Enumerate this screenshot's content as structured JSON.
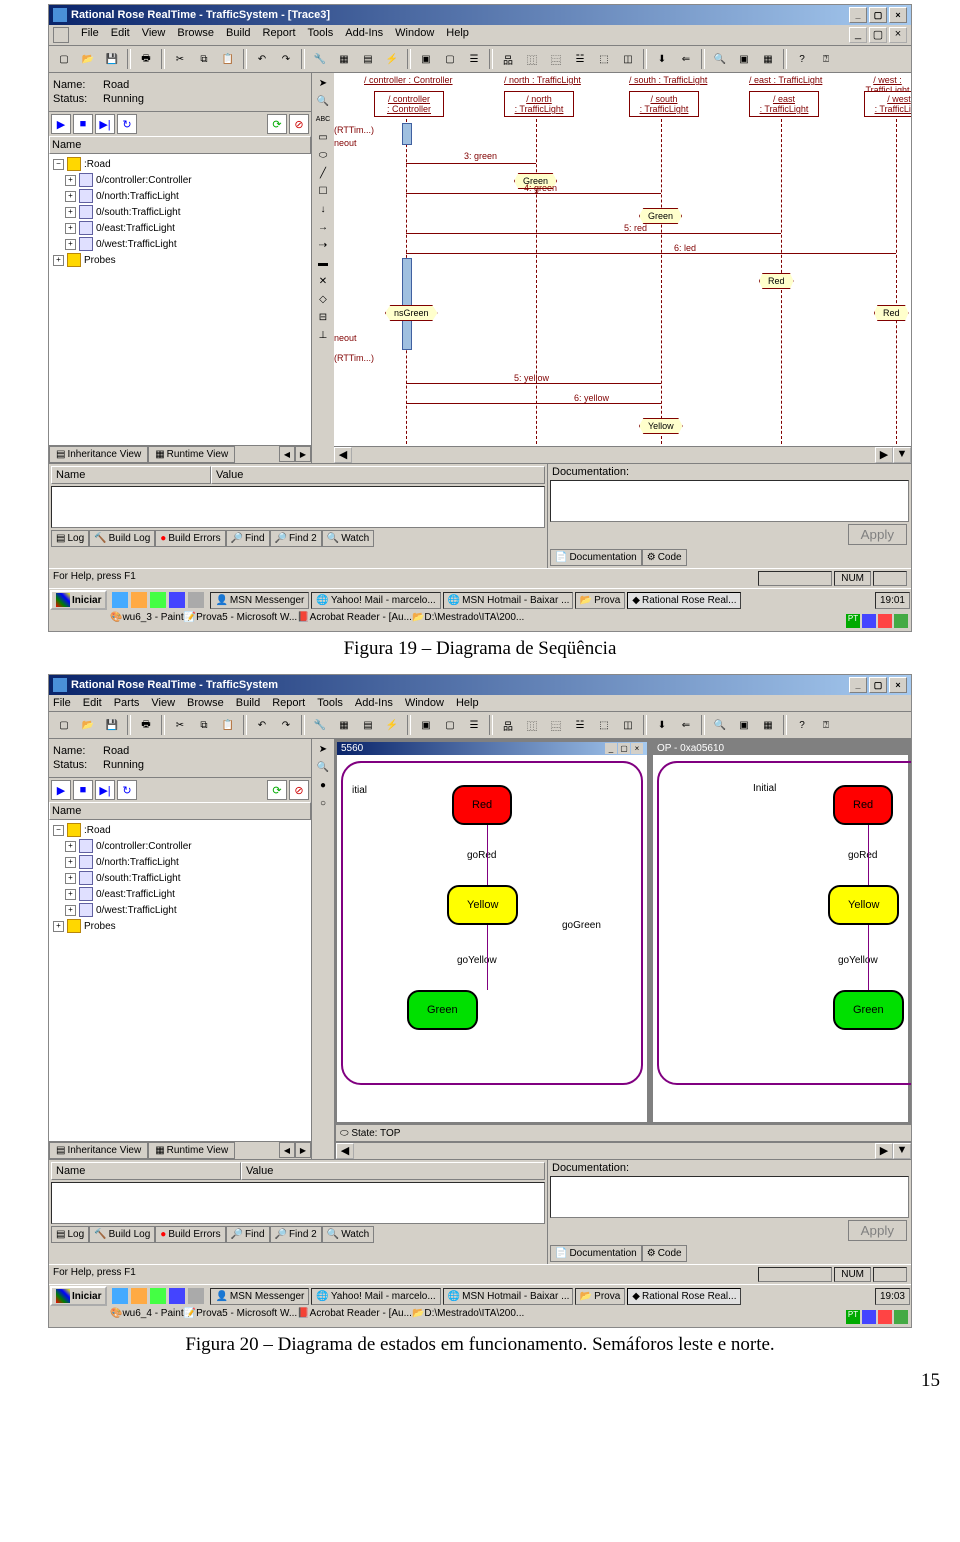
{
  "page_number": "15",
  "caption1": "Figura 19 – Diagrama de Seqüência",
  "caption2": "Figura 20 – Diagrama de estados em funcionamento. Semáforos leste e norte.",
  "shot1": {
    "title": "Rational Rose RealTime - TrafficSystem - [Trace3]",
    "menu": [
      "File",
      "Edit",
      "View",
      "Browse",
      "Build",
      "Report",
      "Tools",
      "Add-Ins",
      "Window",
      "Help"
    ],
    "name_label": "Name:",
    "name_value": "Road",
    "status_label": "Status:",
    "status_value": "Running",
    "tree_hdr": "Name",
    "tree": {
      "root": ":Road",
      "items": [
        "0/controller:Controller",
        "0/north:TrafficLight",
        "0/south:TrafficLight",
        "0/east:TrafficLight",
        "0/west:TrafficLight"
      ],
      "probes": "Probes"
    },
    "tabs": {
      "inh": "Inheritance View",
      "run": "Runtime View"
    },
    "lifelines": [
      {
        "hdr": "/ controller : Controller",
        "box": "/ controller\n: Controller"
      },
      {
        "hdr": "/ north : TrafficLight",
        "box": "/ north\n: TrafficLight"
      },
      {
        "hdr": "/ south : TrafficLight",
        "box": "/ south\n: TrafficLight"
      },
      {
        "hdr": "/ east : TrafficLight",
        "box": "/ east\n: TrafficLight"
      },
      {
        "hdr": "/ west : TrafficLight",
        "box": "/ west\n: TrafficLight"
      }
    ],
    "messages": {
      "m3": "3: green",
      "m4": "4: green",
      "m5": "5: red",
      "m6": "6: led",
      "m5y": "5: yellow",
      "m6y": "6: yellow"
    },
    "states": {
      "green": "Green",
      "red": "Red",
      "yellow": "Yellow",
      "nsGreen": "nsGreen"
    },
    "trunc": {
      "neout": "neout",
      "rttim": "(RTTim...)"
    },
    "bottom": {
      "name": "Name",
      "value": "Value",
      "doc": "Documentation:",
      "apply": "Apply",
      "tabs": [
        "Log",
        "Build Log",
        "Build Errors",
        "Find",
        "Find 2",
        "Watch"
      ],
      "rtabs": [
        "Documentation",
        "Code"
      ]
    },
    "status": {
      "help": "For Help, press F1",
      "num": "NUM"
    },
    "taskbar": {
      "start": "Iniciar",
      "tasks1": [
        "MSN Messenger",
        "Yahoo! Mail - marcelo...",
        "MSN Hotmail - Baixar ...",
        "Prova",
        "Rational Rose Real..."
      ],
      "tasks2": [
        "wu6_3 - Paint",
        "Prova5 - Microsoft W...",
        "Acrobat Reader - [Au...",
        "D:\\Mestrado\\ITA\\200..."
      ],
      "time": "19:01"
    }
  },
  "shot2": {
    "title": "Rational Rose RealTime - TrafficSystem",
    "menu": [
      "File",
      "Edit",
      "Parts",
      "View",
      "Browse",
      "Build",
      "Report",
      "Tools",
      "Add-Ins",
      "Window",
      "Help"
    ],
    "name_label": "Name:",
    "name_value": "Road",
    "status_label": "Status:",
    "status_value": "Running",
    "tree_hdr": "Name",
    "tree": {
      "root": ":Road",
      "items": [
        "0/controller:Controller",
        "0/north:TrafficLight",
        "0/south:TrafficLight",
        "0/east:TrafficLight",
        "0/west:TrafficLight"
      ],
      "probes": "Probes"
    },
    "tabs": {
      "inh": "Inheritance View",
      "run": "Runtime View"
    },
    "win1_title": "5560",
    "win2_title": "OP - 0xa05610",
    "states": {
      "initial": "Initial",
      "red": "Red",
      "yellow": "Yellow",
      "green": "Green"
    },
    "transitions": {
      "goRed": "goRed",
      "goYellow": "goYellow",
      "goGreen": "goGreen"
    },
    "statebar": "State: TOP",
    "bottom": {
      "name": "Name",
      "value": "Value",
      "doc": "Documentation:",
      "apply": "Apply",
      "tabs": [
        "Log",
        "Build Log",
        "Build Errors",
        "Find",
        "Find 2",
        "Watch"
      ],
      "rtabs": [
        "Documentation",
        "Code"
      ]
    },
    "status": {
      "help": "For Help, press F1",
      "num": "NUM"
    },
    "taskbar": {
      "start": "Iniciar",
      "tasks1": [
        "MSN Messenger",
        "Yahoo! Mail - marcelo...",
        "MSN Hotmail - Baixar ...",
        "Prova",
        "Rational Rose Real..."
      ],
      "tasks2": [
        "wu6_4 - Paint",
        "Prova5 - Microsoft W...",
        "Acrobat Reader - [Au...",
        "D:\\Mestrado\\ITA\\200..."
      ],
      "time": "19:03"
    }
  }
}
